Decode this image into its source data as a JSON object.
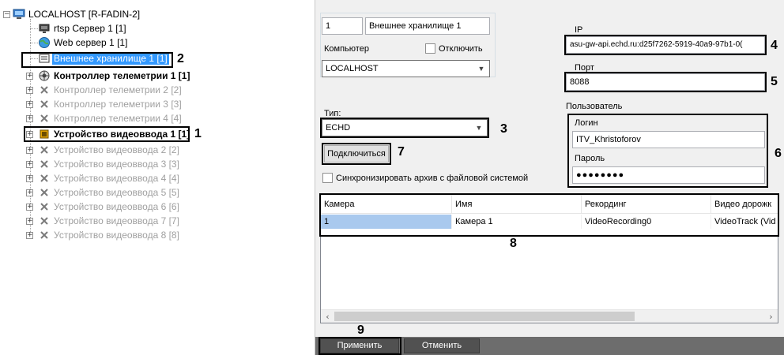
{
  "tree": {
    "root": "LOCALHOST [R-FADIN-2]",
    "items": [
      {
        "label": "rtsp Сервер 1 [1]",
        "icon": "monitor-icon"
      },
      {
        "label": "Web сервер 1 [1]",
        "icon": "globe-icon"
      },
      {
        "label": "Внешнее хранилище 1 [1]",
        "icon": "storage-icon",
        "selected": true
      },
      {
        "label": "Контроллер телеметрии 1 [1]",
        "icon": "telemetry-icon"
      },
      {
        "label": "Контроллер телеметрии 2 [2]",
        "icon": "cross-icon",
        "disabled": true
      },
      {
        "label": "Контроллер телеметрии 3 [3]",
        "icon": "cross-icon",
        "disabled": true
      },
      {
        "label": "Контроллер телеметрии 4 [4]",
        "icon": "cross-icon",
        "disabled": true
      },
      {
        "label": "Устройство видеоввода 1 [1]",
        "icon": "chip-icon"
      },
      {
        "label": "Устройство видеоввода 2 [2]",
        "icon": "cross-icon",
        "disabled": true
      },
      {
        "label": "Устройство видеоввода 3 [3]",
        "icon": "cross-icon",
        "disabled": true
      },
      {
        "label": "Устройство видеоввода 4 [4]",
        "icon": "cross-icon",
        "disabled": true
      },
      {
        "label": "Устройство видеоввода 5 [5]",
        "icon": "cross-icon",
        "disabled": true
      },
      {
        "label": "Устройство видеоввода 6 [6]",
        "icon": "cross-icon",
        "disabled": true
      },
      {
        "label": "Устройство видеоввода 7 [7]",
        "icon": "cross-icon",
        "disabled": true
      },
      {
        "label": "Устройство видеоввода 8 [8]",
        "icon": "cross-icon",
        "disabled": true
      }
    ]
  },
  "callouts": {
    "c1": "1",
    "c2": "2",
    "c3": "3",
    "c4": "4",
    "c5": "5",
    "c6": "6",
    "c7": "7",
    "c8": "8",
    "c9": "9"
  },
  "panel": {
    "id_value": "1",
    "name_value": "Внешнее хранилище 1",
    "computer_label": "Компьютер",
    "disable_label": "Отключить",
    "computer_value": "LOCALHOST",
    "ip_label": "IP",
    "ip_value": "asu-gw-api.echd.ru:d25f7262-5919-40a9-97b1-0(",
    "port_label": "Порт",
    "port_value": "8088",
    "type_label": "Тип:",
    "type_value": "ECHD",
    "user_label": "Пользователь",
    "login_label": "Логин",
    "login_value": "ITV_Khristoforov",
    "password_label": "Пароль",
    "password_value": "●●●●●●●●",
    "connect_label": "Подключиться",
    "sync_label": "Синхронизировать архив с файловой системой"
  },
  "grid": {
    "headers": [
      "Камера",
      "Имя",
      "Рекординг",
      "Видео дорожк"
    ],
    "rows": [
      [
        "1",
        "Камера 1",
        "VideoRecording0",
        "VideoTrack (Vid"
      ]
    ]
  },
  "buttons": {
    "apply": "Применить",
    "cancel": "Отменить"
  },
  "colors": {
    "selection": "#3399ff",
    "bottom_bar": "#6d6d6d",
    "panel_bg": "#f0f0f0"
  }
}
